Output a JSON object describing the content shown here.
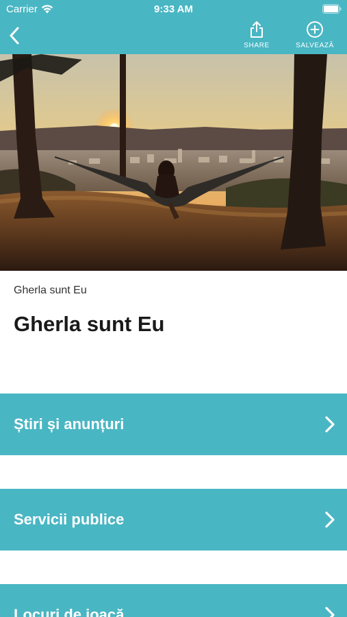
{
  "status_bar": {
    "carrier": "Carrier",
    "time": "9:33 AM",
    "wifi_icon": "wifi-icon",
    "battery_icon": "battery-icon"
  },
  "nav": {
    "back_icon": "chevron-left-icon",
    "share_label": "SHARE",
    "share_icon": "share-icon",
    "save_label": "SALVEAZĂ",
    "save_icon": "plus-circle-icon"
  },
  "hero": {
    "description": "hammock-sunset-photo"
  },
  "header": {
    "subtitle": "Gherla sunt Eu",
    "title": "Gherla sunt Eu"
  },
  "menu": {
    "items": [
      {
        "label": "Știri și anunțuri"
      },
      {
        "label": "Servicii publice"
      },
      {
        "label": "Locuri de joacă"
      }
    ]
  },
  "colors": {
    "accent": "#49b6c3",
    "text_dark": "#1a1a1a",
    "background": "#ffffff"
  }
}
